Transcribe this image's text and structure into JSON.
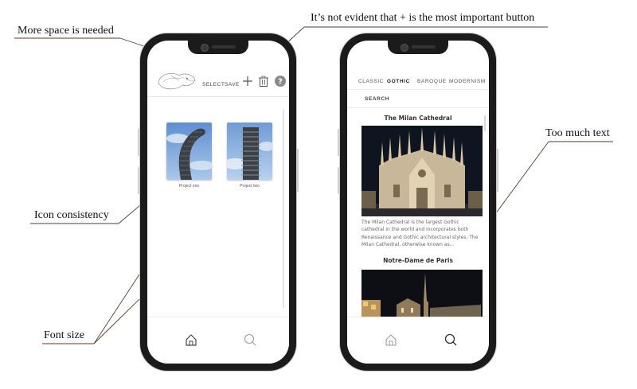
{
  "annotations": {
    "more_space": "More space is needed",
    "important_button": "It’s not evident that + is the most important button",
    "too_much_text": "Too much text",
    "icon_consistency": "Icon consistency",
    "font_size": "Font size"
  },
  "phone1": {
    "toolbar": {
      "select_label": "SELECT",
      "save_label": "SAVE"
    },
    "projects": [
      {
        "label": "Project one"
      },
      {
        "label": "Project two"
      }
    ]
  },
  "phone2": {
    "tabs": [
      {
        "label": "CLASSIC",
        "active": false
      },
      {
        "label": "GOTHIC",
        "active": true
      },
      {
        "label": "BAROQUE",
        "active": false
      },
      {
        "label": "MODERNISM",
        "active": false
      }
    ],
    "search_label": "SEARCH",
    "cards": [
      {
        "title": "The Milan Cathedral",
        "description": "The Milan Cathedral is the largest Gothic cathedral in the world and incorporates both Renaissance and Gothic architectural styles. The Milan Cathedral, otherwise known as..."
      },
      {
        "title": "Notre-Dame de Paris"
      }
    ]
  },
  "colors": {
    "frame": "#1b1b1b",
    "annotation_line": "#5a3a2a",
    "night_sky": "#0e1420"
  },
  "icons": [
    "plus-icon",
    "trash-icon",
    "help-icon",
    "home-icon",
    "search-icon",
    "logo-icon"
  ]
}
